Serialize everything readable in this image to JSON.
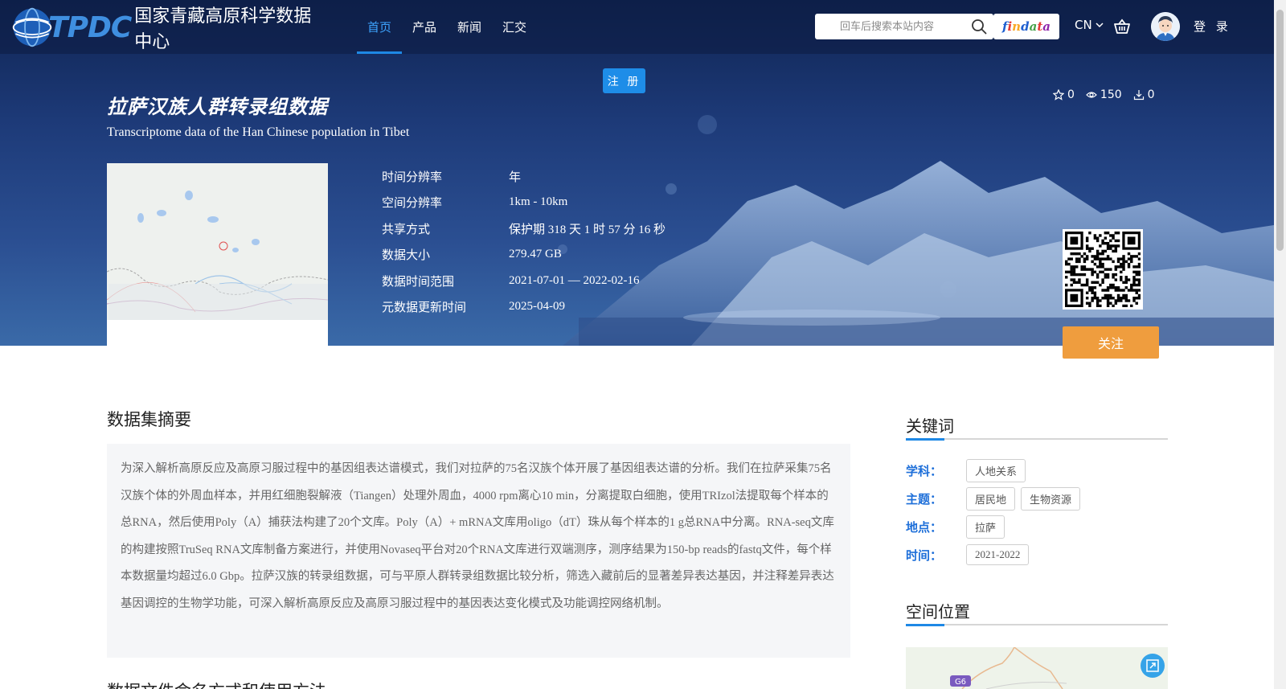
{
  "nav": {
    "logo_text": "TPDC",
    "logo_cn": "国家青藏高原科学数据中心",
    "menu": [
      {
        "label": "首页"
      },
      {
        "label": "产品"
      },
      {
        "label": "新闻"
      },
      {
        "label": "汇交"
      }
    ],
    "search_placeholder": "回车后搜索本站内容",
    "findata_letters": [
      "f",
      "i",
      "n",
      "d",
      "a",
      "t",
      "a"
    ],
    "lang": "CN",
    "login": "登 录",
    "register": "注 册"
  },
  "dataset": {
    "title_cn": "拉萨汉族人群转录组数据",
    "title_en": "Transcriptome data of the Han Chinese population in Tibet",
    "stats": {
      "favorites": "0",
      "views": "150",
      "downloads": "0"
    },
    "info": [
      {
        "label": "时间分辨率",
        "value": "年"
      },
      {
        "label": "空间分辨率",
        "value": "1km - 10km"
      },
      {
        "label": "共享方式",
        "value": "保护期 318 天 1 时 57 分 16 秒"
      },
      {
        "label": "数据大小",
        "value": "279.47 GB"
      },
      {
        "label": "数据时间范围",
        "value": "2021-07-01 — 2022-02-16"
      },
      {
        "label": "元数据更新时间",
        "value": "2025-04-09"
      }
    ],
    "follow": "关注"
  },
  "abstract": {
    "title": "数据集摘要",
    "text": "为深入解析高原反应及高原习服过程中的基因组表达谱模式，我们对拉萨的75名汉族个体开展了基因组表达谱的分析。我们在拉萨采集75名汉族个体的外周血样本，并用红细胞裂解液（Tiangen）处理外周血，4000 rpm离心10 min，分离提取白细胞，使用TRIzol法提取每个样本的总RNA，然后使用Poly（A）捕获法构建了20个文库。Poly（A）+ mRNA文库用oligo（dT）珠从每个样本的1 g总RNA中分离。RNA-seq文库的构建按照TruSeq RNA文库制备方案进行，并使用Novaseq平台对20个RNA文库进行双端测序，测序结果为150-bp reads的fastq文件，每个样本数据量均超过6.0 Gbp。拉萨汉族的转录组数据，可与平原人群转录组数据比较分析，筛选入藏前后的显著差异表达基因，并注释差异表达基因调控的生物学功能，可深入解析高原反应及高原习服过程中的基因表达变化模式及功能调控网络机制。",
    "next_title": "数据文件命名方式和使用方法"
  },
  "keywords": {
    "title": "关键词",
    "rows": [
      {
        "label": "学科：",
        "tags": [
          "人地关系"
        ]
      },
      {
        "label": "主题：",
        "tags": [
          "居民地",
          "生物资源"
        ]
      },
      {
        "label": "地点：",
        "tags": [
          "拉萨"
        ]
      },
      {
        "label": "时间：",
        "tags": [
          "2021-2022"
        ]
      }
    ]
  },
  "spatial": {
    "title": "空间位置",
    "road_label": "G6"
  },
  "colors": {
    "accent": "#1e88e5",
    "follow": "#ef9d3e",
    "keyword_label": "#1e6fd9"
  }
}
